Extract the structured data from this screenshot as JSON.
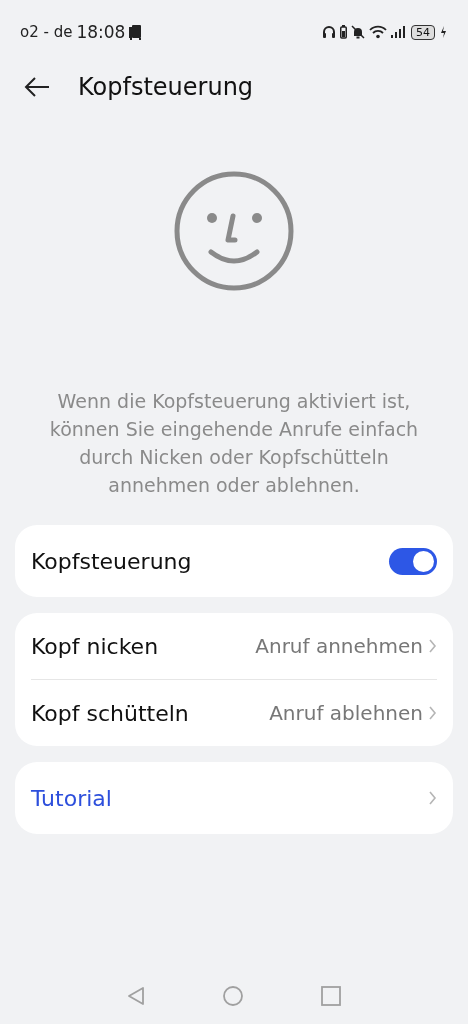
{
  "status_bar": {
    "carrier": "o2 - de",
    "time": "18:08",
    "battery": "54"
  },
  "header": {
    "title": "Kopfsteuerung"
  },
  "description": "Wenn die Kopfsteuerung aktiviert ist, können Sie eingehende Anrufe einfach durch Nicken oder Kopfschütteln annehmen oder ablehnen.",
  "groups": [
    {
      "items": [
        {
          "kind": "toggle",
          "label": "Kopfsteuerung",
          "on": true
        }
      ]
    },
    {
      "items": [
        {
          "kind": "link",
          "label": "Kopf nicken",
          "value": "Anruf annehmen"
        },
        {
          "kind": "link",
          "label": "Kopf schütteln",
          "value": "Anruf ablehnen"
        }
      ]
    },
    {
      "items": [
        {
          "kind": "accent-link",
          "label": "Tutorial"
        }
      ]
    }
  ]
}
